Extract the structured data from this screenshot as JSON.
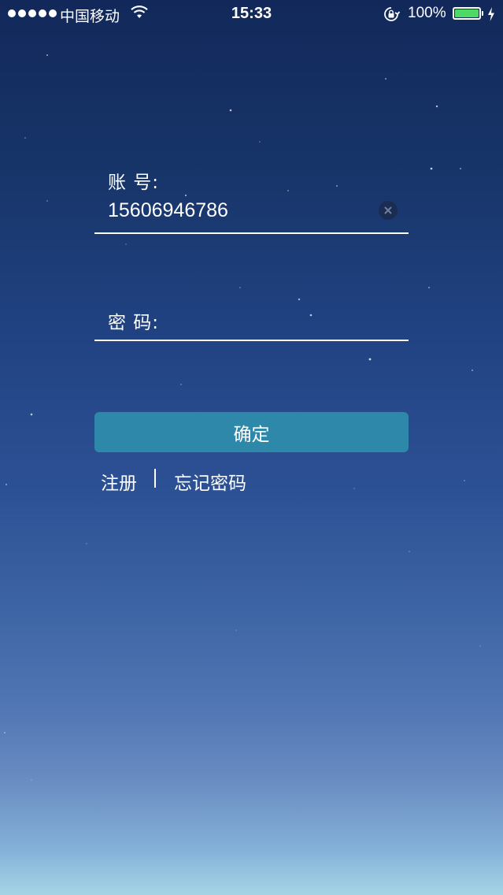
{
  "status_bar": {
    "carrier": "中国移动",
    "time": "15:33",
    "battery_percent": "100%",
    "battery_level": 1.0,
    "icons": [
      "signal-dots",
      "wifi-icon",
      "rotation-lock-icon",
      "battery-icon",
      "charging-bolt-icon"
    ]
  },
  "login_form": {
    "account_label": "账 号:",
    "account_value": "15606946786",
    "password_label": "密 码:",
    "password_value": "",
    "confirm_label": "确定",
    "register_label": "注册",
    "forgot_label": "忘记密码"
  },
  "colors": {
    "button": "#2e88aa",
    "background_top": "#12285a",
    "background_bottom": "#a6d4e6",
    "battery_fill": "#4cd964"
  }
}
